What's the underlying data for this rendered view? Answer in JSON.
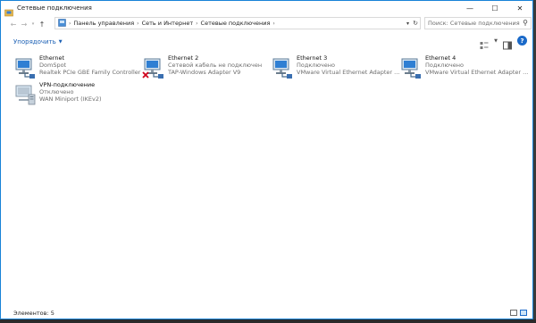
{
  "window": {
    "title": "Сетевые подключения",
    "icon": "network-folder-icon",
    "controls": {
      "minimize": "—",
      "maximize": "☐",
      "close": "✕"
    }
  },
  "nav": {
    "back_icon": "arrow-left-icon",
    "forward_icon": "arrow-right-icon",
    "up_icon": "arrow-up-icon"
  },
  "address": {
    "crumbs": [
      "Панель управления",
      "Сеть и Интернет",
      "Сетевые подключения"
    ]
  },
  "search": {
    "placeholder": "Поиск: Сетевые подключения"
  },
  "toolbar": {
    "organize_label": "Упорядочить"
  },
  "connections": [
    {
      "name": "Ethernet",
      "status": "DomSpot",
      "adapter": "Realtek PCIe GBE Family Controller",
      "disconnected": false
    },
    {
      "name": "Ethernet 2",
      "status": "Сетевой кабель не подключен",
      "adapter": "TAP-Windows Adapter V9",
      "disconnected": true
    },
    {
      "name": "Ethernet 3",
      "status": "Подключено",
      "adapter": "VMware Virtual Ethernet Adapter ...",
      "disconnected": false
    },
    {
      "name": "Ethernet 4",
      "status": "Подключено",
      "adapter": "VMware Virtual Ethernet Adapter ...",
      "disconnected": false
    },
    {
      "name": "VPN-подключение",
      "status": "Отключено",
      "adapter": "WAN Miniport (IKEv2)",
      "disconnected": false,
      "vpn": true
    }
  ],
  "statusbar": {
    "items_label": "Элементов: 5"
  },
  "colors": {
    "accent": "#1883d7",
    "link": "#1a5fb4",
    "help": "#1b6ac9",
    "disconnect_x": "#d0021b"
  }
}
